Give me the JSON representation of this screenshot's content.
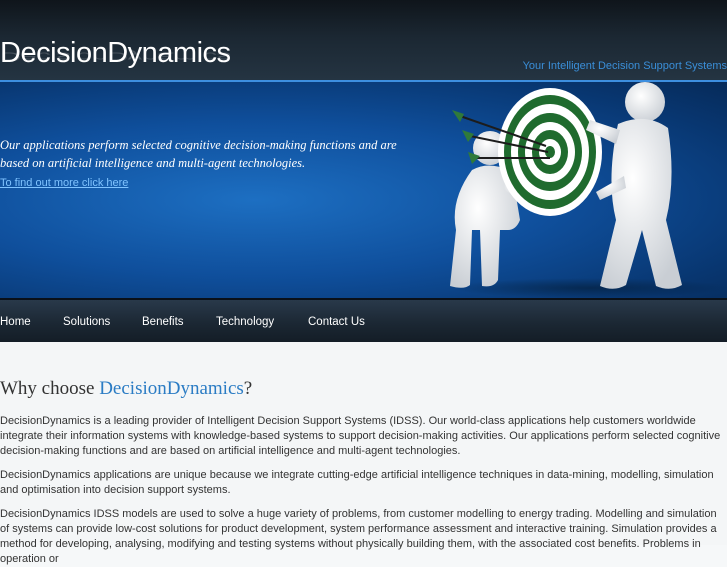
{
  "header": {
    "logo": "DecisionDynamics",
    "tagline": "Your Intelligent Decision Support Systems"
  },
  "banner": {
    "text": "Our applications perform selected cognitive decision-making functions and are based on artificial intelligence and multi-agent technologies.",
    "link": "To find out more click here",
    "illustration_icon": "target-with-arrows-figures"
  },
  "nav": {
    "items": [
      {
        "label": "Home"
      },
      {
        "label": "Solutions"
      },
      {
        "label": "Benefits"
      },
      {
        "label": "Technology"
      },
      {
        "label": "Contact Us"
      }
    ]
  },
  "content": {
    "title_prefix": "Why choose ",
    "title_brand": "DecisionDynamics",
    "title_suffix": "?",
    "paragraphs": [
      "DecisionDynamics is a leading provider of Intelligent Decision Support Systems (IDSS). Our world-class applications help customers worldwide integrate their information systems with knowledge-based systems to support decision-making activities. Our applications perform selected cognitive decision-making functions and are based on artificial intelligence and multi-agent technologies.",
      "DecisionDynamics applications are unique because we integrate cutting-edge artificial intelligence techniques in data-mining, modelling, simulation and optimisation into decision support systems.",
      "DecisionDynamics IDSS models are used to solve a huge variety of problems, from customer modelling to energy trading. Modelling and simulation of systems can provide low-cost solutions for product development, system performance assessment and interactive training. Simulation provides a method for developing, analysing, modifying and testing systems without physically building them, with the associated cost benefits. Problems in operation or"
    ]
  },
  "colors": {
    "accent": "#2b7cc4",
    "tagline": "#3a8ed8",
    "link": "#7fc3ff",
    "banner": "#0f4f9c",
    "target_green": "#1f6b2e"
  }
}
